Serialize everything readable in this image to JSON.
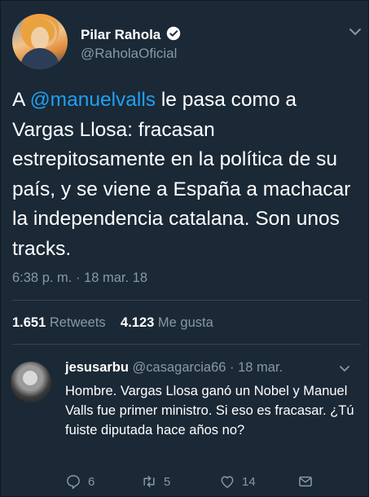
{
  "tweet": {
    "author_name": "Pilar Rahola",
    "author_handle": "@RaholaOficial",
    "text_before": "A ",
    "mention": "@manuelvalls",
    "text_after": " le pasa como a Vargas Llosa: fracasan estrepitosamente en la política de su país, y se viene a España a machacar la independencia catalana. Son unos tracks.",
    "timestamp": "6:38 p. m. · 18 mar. 18",
    "retweets_count": "1.651",
    "retweets_label": "Retweets",
    "likes_count": "4.123",
    "likes_label": "Me gusta"
  },
  "reply": {
    "user": "jesusarbu",
    "handle": "@casagarcia66",
    "separator": " · ",
    "date": "18 mar.",
    "text": "Hombre. Vargas Llosa ganó un Nobel y Manuel Valls fue primer ministro. Si eso es fracasar. ¿Tú fuiste diputada hace años no?",
    "reply_count": "6",
    "retweet_count": "5",
    "like_count": "14"
  },
  "colors": {
    "background": "#1b2836",
    "text": "#ffffff",
    "muted": "#8899a6",
    "accent": "#1da1f2",
    "divider": "#38444d"
  },
  "icons": [
    "verified-badge-icon",
    "chevron-down-icon",
    "reply-icon",
    "retweet-icon",
    "heart-icon",
    "direct-message-icon"
  ]
}
